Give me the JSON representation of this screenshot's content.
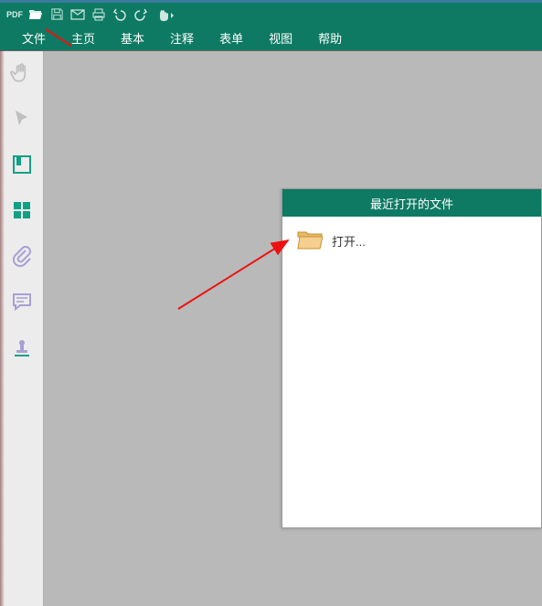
{
  "qat": {
    "pdf_label": "PDF"
  },
  "menu": {
    "file": "文件",
    "home": "主页",
    "basic": "基本",
    "annotate": "注释",
    "form": "表单",
    "view": "视图",
    "help": "帮助"
  },
  "panel": {
    "title": "最近打开的文件",
    "open_label": "打开..."
  }
}
